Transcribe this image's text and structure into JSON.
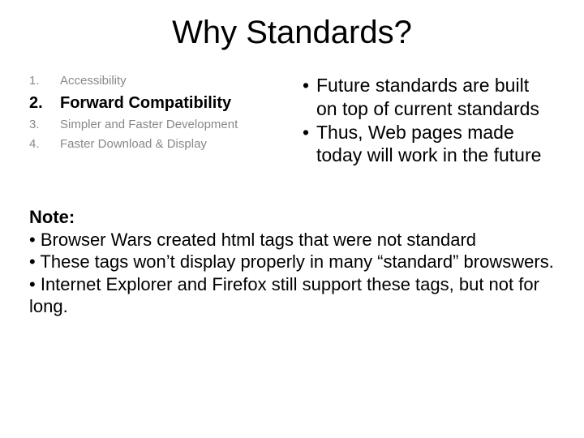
{
  "title": "Why Standards?",
  "leftList": [
    {
      "num": "1.",
      "text": "Accessibility",
      "bold": false
    },
    {
      "num": "2.",
      "text": "Forward Compatibility",
      "bold": true
    },
    {
      "num": "3.",
      "text": "Simpler and Faster Development",
      "bold": false
    },
    {
      "num": "4.",
      "text": "Faster Download & Display",
      "bold": false
    }
  ],
  "bullets": {
    "b1": "Future standards are built on top of current standards",
    "b2": "Thus, Web pages made today will work in the future"
  },
  "note": {
    "label": "Note:",
    "n1": "Browser Wars created html tags that were not standard",
    "n2": "These tags won’t display properly in many “standard” browswers.",
    "n3": "Internet Explorer and Firefox still support these tags, but not for long."
  },
  "dot": "•"
}
